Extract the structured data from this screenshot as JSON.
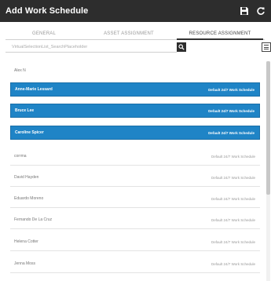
{
  "window": {
    "title": "Add Work Schedule"
  },
  "toolbar": {
    "save_icon": "save-icon",
    "refresh_icon": "refresh-icon"
  },
  "tabs": [
    {
      "label": "GENERAL",
      "active": false
    },
    {
      "label": "ASSET ASSIGNMENT",
      "active": false
    },
    {
      "label": "RESOURCE ASSIGNMENT",
      "active": true
    }
  ],
  "search": {
    "placeholder": "VirtualSelectionList_SearchPlaceholder",
    "value": ""
  },
  "resources": [
    {
      "name": "Alex N",
      "schedule": "",
      "selected": false
    },
    {
      "name": "Anne-Marie Lessard",
      "schedule": "Default 24/7 Work Schedule",
      "selected": true
    },
    {
      "name": "Bruce Lee",
      "schedule": "Default 24/7 Work Schedule",
      "selected": true
    },
    {
      "name": "Caroline Spicer",
      "schedule": "Default 24/7 Work Schedule",
      "selected": true
    },
    {
      "name": "corrma",
      "schedule": "Default 24/7 Work Schedule",
      "selected": false
    },
    {
      "name": "David Hayden",
      "schedule": "Default 24/7 Work Schedule",
      "selected": false
    },
    {
      "name": "Eduardo Moreno",
      "schedule": "Default 24/7 Work Schedule",
      "selected": false
    },
    {
      "name": "Fernando De La Cruz",
      "schedule": "Default 24/7 Work Schedule",
      "selected": false
    },
    {
      "name": "Helena Cotter",
      "schedule": "Default 24/7 Work Schedule",
      "selected": false
    },
    {
      "name": "Jenna Moss",
      "schedule": "Default 24/7 Work Schedule",
      "selected": false
    }
  ],
  "colors": {
    "titlebar": "#2d2d2d",
    "selected_row": "#1f84c6"
  }
}
